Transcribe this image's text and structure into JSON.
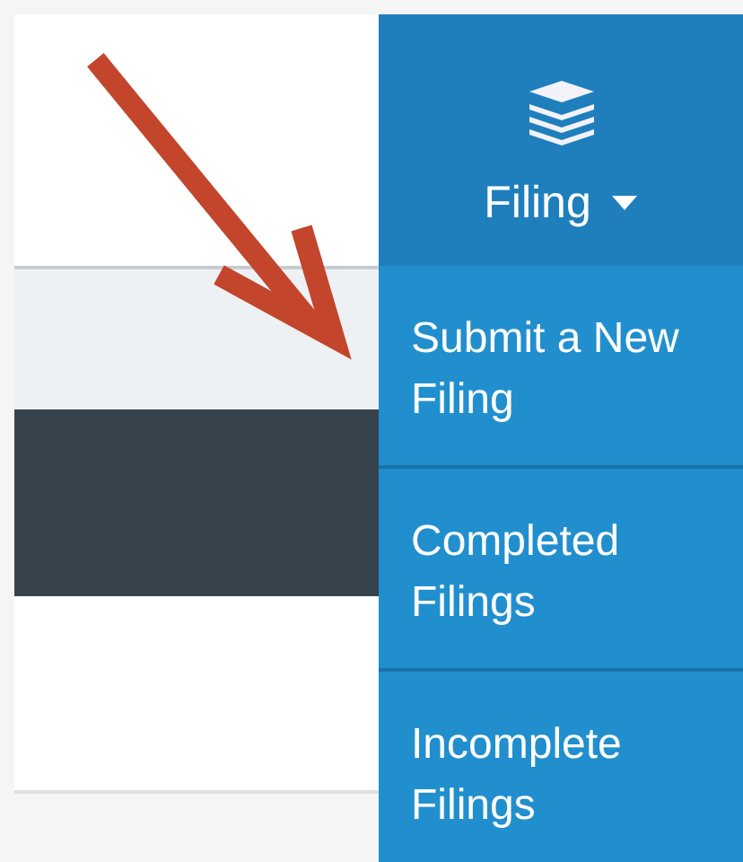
{
  "nav": {
    "label": "Filing",
    "expanded": true
  },
  "menu_items": [
    {
      "label": "Submit a New Filing"
    },
    {
      "label": "Completed Filings"
    },
    {
      "label": "Incomplete Filings"
    }
  ]
}
